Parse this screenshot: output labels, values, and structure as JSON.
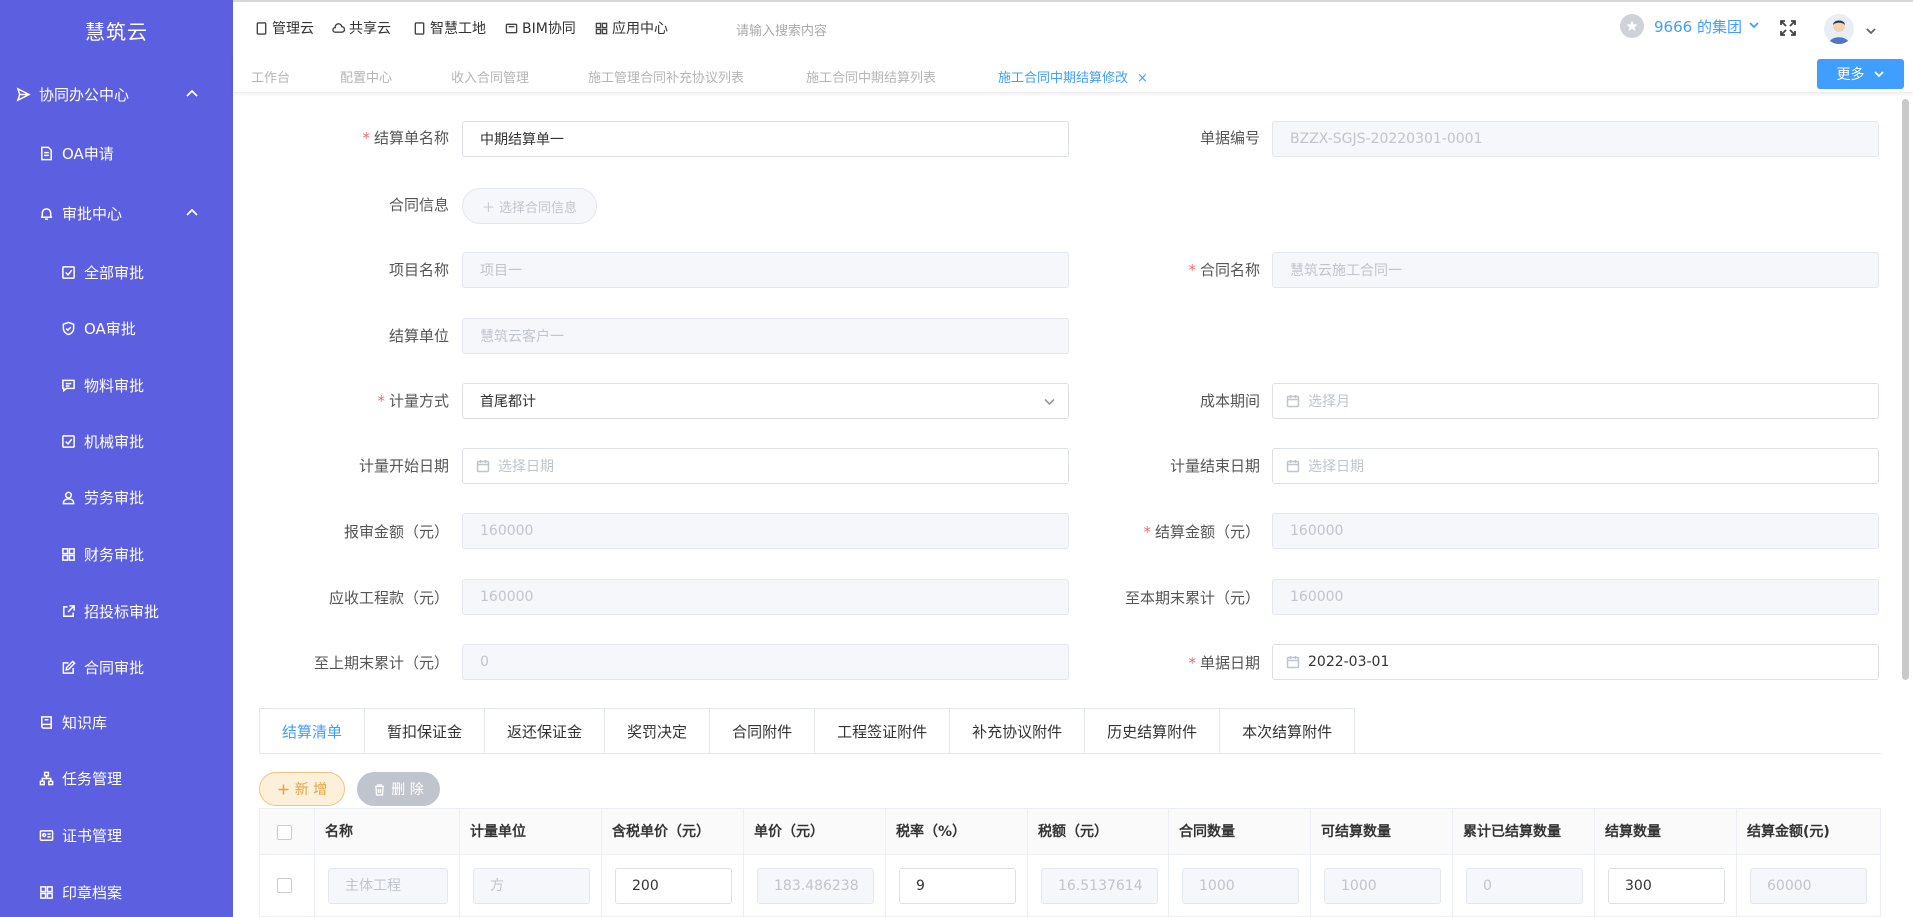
{
  "app": {
    "brand": "慧筑云"
  },
  "sidebar": {
    "items": [
      {
        "label": "协同办公中心",
        "icon": "send-icon",
        "expanded": true
      },
      {
        "label": "OA申请",
        "icon": "document-icon"
      },
      {
        "label": "审批中心",
        "icon": "bell-icon",
        "expanded": true
      },
      {
        "label": "全部审批",
        "icon": "check-square-icon"
      },
      {
        "label": "OA审批",
        "icon": "shield-check-icon"
      },
      {
        "label": "物料审批",
        "icon": "message-icon"
      },
      {
        "label": "机械审批",
        "icon": "check-square-icon"
      },
      {
        "label": "劳务审批",
        "icon": "user-icon"
      },
      {
        "label": "财务审批",
        "icon": "grid-icon"
      },
      {
        "label": "招投标审批",
        "icon": "external-link-icon"
      },
      {
        "label": "合同审批",
        "icon": "edit-icon"
      },
      {
        "label": "知识库",
        "icon": "book-icon"
      },
      {
        "label": "任务管理",
        "icon": "sitemap-icon"
      },
      {
        "label": "证书管理",
        "icon": "id-card-icon"
      },
      {
        "label": "印章档案",
        "icon": "grid-icon"
      }
    ]
  },
  "topnav": {
    "items": [
      {
        "label": "管理云",
        "icon": "tablet-icon"
      },
      {
        "label": "共享云",
        "icon": "cloud-icon"
      },
      {
        "label": "智慧工地",
        "icon": "tablet-icon"
      },
      {
        "label": "BIM协同",
        "icon": "box-icon"
      },
      {
        "label": "应用中心",
        "icon": "grid-icon"
      }
    ],
    "search_placeholder": "请输入搜索内容",
    "group": "9666 的集团"
  },
  "tabs": {
    "items": [
      {
        "label": "工作台"
      },
      {
        "label": "配置中心"
      },
      {
        "label": "收入合同管理"
      },
      {
        "label": "施工管理合同补充协议列表"
      },
      {
        "label": "施工合同中期结算列表"
      },
      {
        "label": "施工合同中期结算修改",
        "active": true
      }
    ],
    "close": "×",
    "more": "更多"
  },
  "form": {
    "settlement_name": {
      "label": "结算单名称",
      "value": "中期结算单一",
      "required": true
    },
    "doc_no": {
      "label": "单据编号",
      "value": "BZZX-SGJS-20220301-0001"
    },
    "contract_info": {
      "label": "合同信息",
      "button": "＋ 选择合同信息"
    },
    "project_name": {
      "label": "项目名称",
      "value": "项目一"
    },
    "contract_name": {
      "label": "合同名称",
      "value": "慧筑云施工合同一",
      "required": true
    },
    "settle_unit": {
      "label": "结算单位",
      "value": "慧筑云客户一"
    },
    "measure_method": {
      "label": "计量方式",
      "value": "首尾都计",
      "required": true
    },
    "cost_period": {
      "label": "成本期间",
      "placeholder": "选择月"
    },
    "measure_start": {
      "label": "计量开始日期",
      "placeholder": "选择日期"
    },
    "measure_end": {
      "label": "计量结束日期",
      "placeholder": "选择日期"
    },
    "report_amount": {
      "label": "报审金额（元）",
      "value": "160000"
    },
    "settle_amount": {
      "label": "结算金额（元）",
      "value": "160000",
      "required": true
    },
    "receivable": {
      "label": "应收工程款（元）",
      "value": "160000"
    },
    "cum_current": {
      "label": "至本期末累计（元）",
      "value": "160000"
    },
    "cum_prev": {
      "label": "至上期末累计（元）",
      "value": "0"
    },
    "doc_date": {
      "label": "单据日期",
      "value": "2022-03-01",
      "required": true
    }
  },
  "detail_tabs": [
    "结算清单",
    "暂扣保证金",
    "返还保证金",
    "奖罚决定",
    "合同附件",
    "工程签证附件",
    "补充协议附件",
    "历史结算附件",
    "本次结算附件"
  ],
  "actions": {
    "add": "新 增",
    "delete": "删 除"
  },
  "table": {
    "columns": [
      "名称",
      "计量单位",
      "含税单价（元）",
      "单价（元）",
      "税率（%）",
      "税额（元）",
      "合同数量",
      "可结算数量",
      "累计已结算数量",
      "结算数量",
      "结算金额(元)"
    ],
    "rows": [
      [
        "主体工程",
        "方",
        "200",
        "183.486238",
        "9",
        "16.5137614",
        "1000",
        "1000",
        "0",
        "300",
        "60000"
      ]
    ]
  },
  "colors": {
    "sidebar": "#5b5fe0",
    "primary": "#409eff",
    "required": "#f56c6c",
    "warning": "#e6a23c"
  }
}
